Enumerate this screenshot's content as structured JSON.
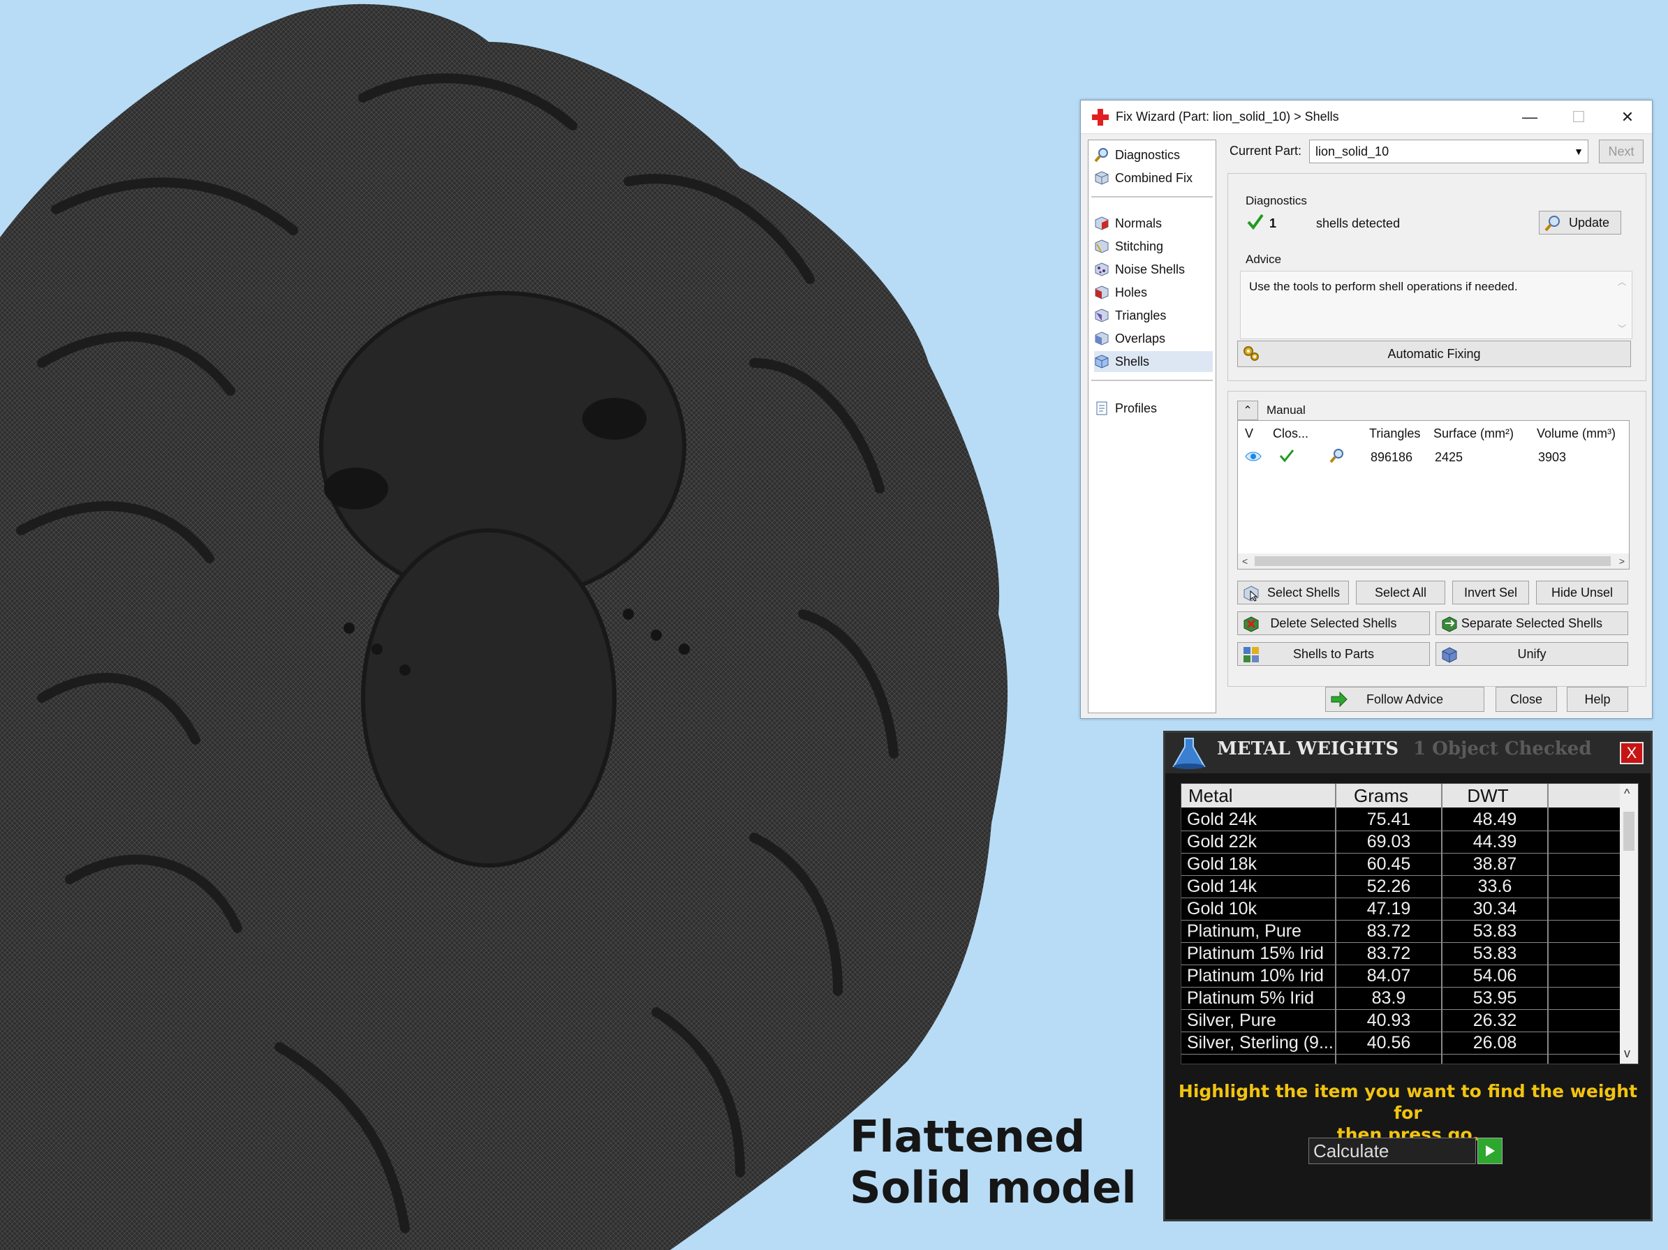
{
  "caption": {
    "line1": "Flattened",
    "line2": "Solid model"
  },
  "fix_wizard": {
    "title": "Fix Wizard (Part: lion_solid_10) > Shells",
    "window_controls": {
      "minimize": "—",
      "maximize": "☐",
      "close": "✕"
    },
    "nav": [
      {
        "label": "Diagnostics",
        "icon": "magnifier-icon"
      },
      {
        "label": "Combined Fix",
        "icon": "cube-icon"
      },
      {
        "label": "Normals",
        "icon": "normals-cube-icon"
      },
      {
        "label": "Stitching",
        "icon": "stitching-cube-icon"
      },
      {
        "label": "Noise Shells",
        "icon": "noise-shells-icon"
      },
      {
        "label": "Holes",
        "icon": "holes-cube-icon"
      },
      {
        "label": "Triangles",
        "icon": "triangles-cube-icon"
      },
      {
        "label": "Overlaps",
        "icon": "overlaps-cube-icon"
      },
      {
        "label": "Shells",
        "icon": "shells-cube-icon",
        "selected": true
      },
      {
        "label": "Profiles",
        "icon": "document-icon"
      }
    ],
    "current_part_label": "Current Part:",
    "current_part_value": "lion_solid_10",
    "next_label": "Next",
    "diagnostics_label": "Diagnostics",
    "shell_count": "1",
    "shells_detected_text": "shells detected",
    "update_label": "Update",
    "advice_label": "Advice",
    "advice_text": "Use the tools to perform shell operations if needed.",
    "automatic_fixing_label": "Automatic Fixing",
    "manual_label": "Manual",
    "table": {
      "headers": [
        "V",
        "Clos...",
        "Triangles",
        "Surface (mm²)",
        "Volume (mm³)"
      ],
      "rows": [
        {
          "triangles": "896186",
          "surface": "2425",
          "volume": "3903"
        }
      ]
    },
    "buttons": {
      "select_shells": "Select Shells",
      "select_all": "Select All",
      "invert_sel": "Invert Sel",
      "hide_unsel": "Hide Unsel",
      "delete_selected": "Delete Selected Shells",
      "separate_selected": "Separate Selected Shells",
      "shells_to_parts": "Shells to Parts",
      "unify": "Unify",
      "follow_advice": "Follow Advice",
      "close": "Close",
      "help": "Help"
    },
    "colors": {
      "check": "#1f9b1f",
      "accent": "#0078d7",
      "title_icon": "#e02020"
    }
  },
  "metal_weights": {
    "title": "METAL WEIGHTS",
    "status": "1 Object Checked",
    "close_label": "X",
    "headers": {
      "metal": "Metal",
      "grams": "Grams",
      "dwt": "DWT"
    },
    "rows": [
      {
        "metal": "Gold 24k",
        "grams": "75.41",
        "dwt": "48.49"
      },
      {
        "metal": "Gold 22k",
        "grams": "69.03",
        "dwt": "44.39"
      },
      {
        "metal": "Gold 18k",
        "grams": "60.45",
        "dwt": "38.87"
      },
      {
        "metal": "Gold 14k",
        "grams": "52.26",
        "dwt": "33.6"
      },
      {
        "metal": "Gold 10k",
        "grams": "47.19",
        "dwt": "30.34"
      },
      {
        "metal": "Platinum, Pure",
        "grams": "83.72",
        "dwt": "53.83"
      },
      {
        "metal": "Platinum 15% Irid",
        "grams": "83.72",
        "dwt": "53.83"
      },
      {
        "metal": "Platinum 10% Irid",
        "grams": "84.07",
        "dwt": "54.06"
      },
      {
        "metal": "Platinum 5% Irid",
        "grams": "83.9",
        "dwt": "53.95"
      },
      {
        "metal": "Silver, Pure",
        "grams": "40.93",
        "dwt": "26.32"
      },
      {
        "metal": "Silver, Sterling (9...",
        "grams": "40.56",
        "dwt": "26.08"
      }
    ],
    "message_line1": "Highlight the item you want to find the weight for",
    "message_line2": "then press go.",
    "calculate_label": "Calculate",
    "colors": {
      "message": "#f2c40f",
      "close_bg": "#c81414",
      "go": "#2ea72e"
    }
  }
}
